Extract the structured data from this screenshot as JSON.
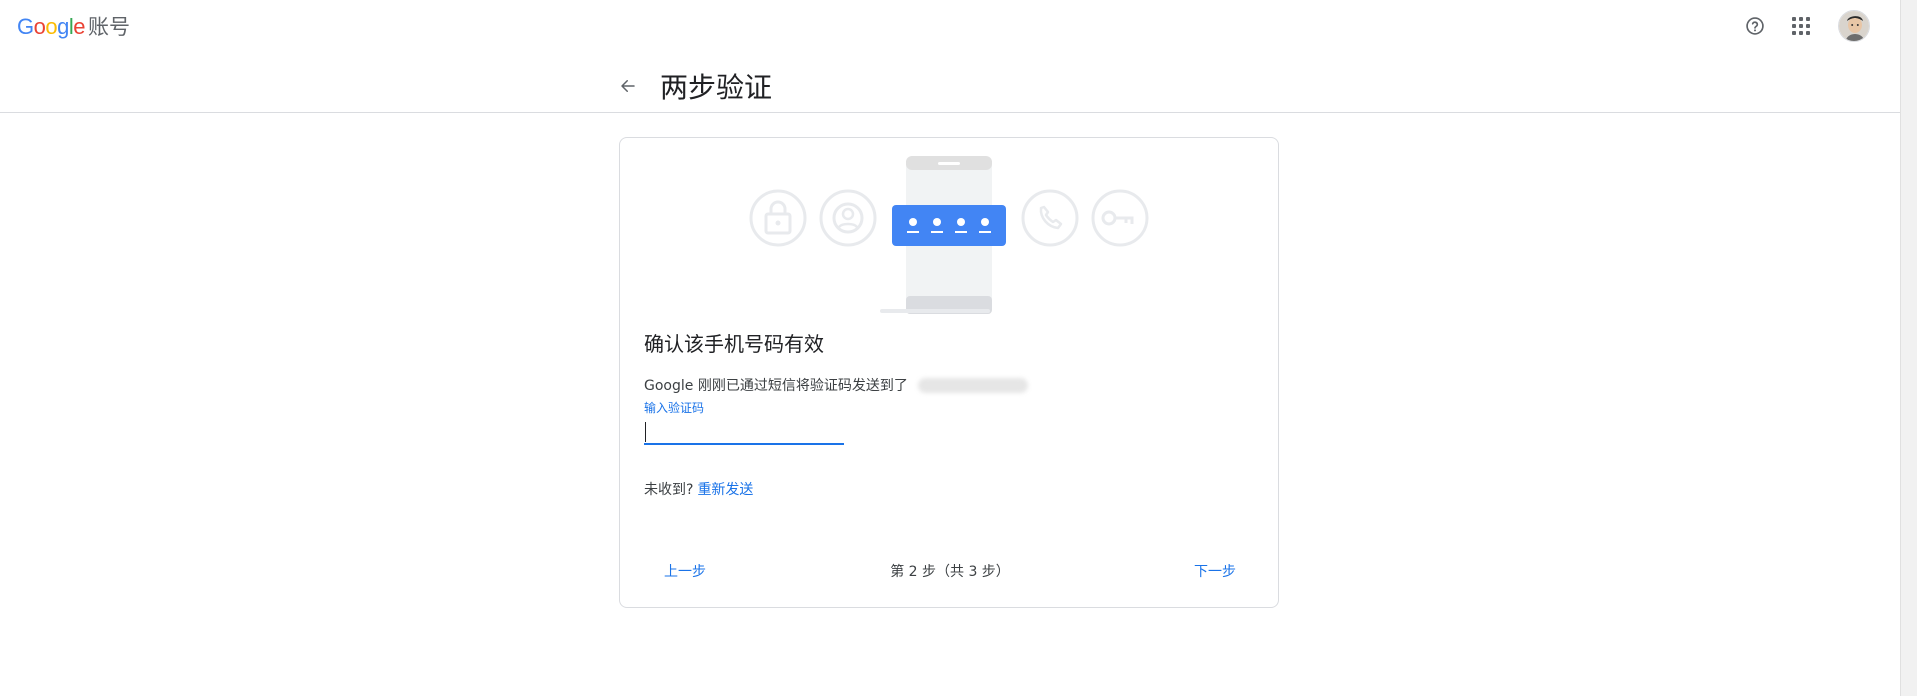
{
  "topbar": {
    "logo_letters": [
      "G",
      "o",
      "o",
      "g",
      "l",
      "e"
    ],
    "logo_colors": [
      "#4285F4",
      "#EA4335",
      "#FBBC05",
      "#4285F4",
      "#34A853",
      "#EA4335"
    ],
    "account_label": "账号",
    "icons": [
      "help-icon",
      "apps-grid-icon",
      "avatar"
    ]
  },
  "header": {
    "back_icon": "arrow-left-icon",
    "title": "两步验证"
  },
  "card": {
    "illustration": {
      "icons": [
        "lock-icon",
        "account-icon",
        "phone-icon",
        "key-icon"
      ],
      "code_dots": 4,
      "accent": "#4285F4"
    },
    "title": "确认该手机号码有效",
    "description": "Google 刚刚已通过短信将验证码发送到了",
    "input_label": "输入验证码",
    "input_value": "",
    "resend_prompt": "未收到?",
    "resend_link": "重新发送",
    "prev_label": "上一步",
    "step_text": "第 2 步（共 3 步）",
    "next_label": "下一步"
  },
  "colors": {
    "link": "#1a73e8",
    "border": "#dadce0",
    "text": "#202124"
  }
}
